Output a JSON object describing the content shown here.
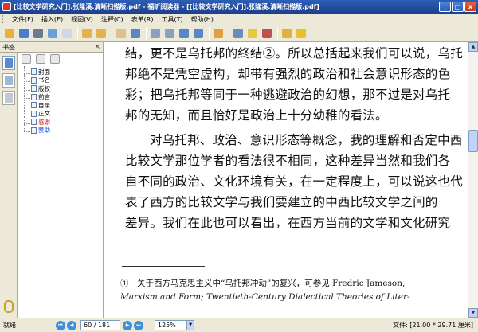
{
  "window": {
    "title": "[比较文学研究入门].张隆溪.清晰扫描版.pdf - 福昕阅读器 - [[比较文学研究入门].张隆溪.清晰扫描版.pdf]",
    "min": "_",
    "max": "□",
    "close": "x"
  },
  "menu": [
    "文件(F)",
    "插入(E)",
    "视图(V)",
    "注释(C)",
    "表单(R)",
    "工具(T)",
    "帮助(H)"
  ],
  "toolbar_icons": [
    {
      "name": "open-icon",
      "color": "#e8b23a"
    },
    {
      "name": "save-icon",
      "color": "#4a7fd0"
    },
    {
      "name": "print-icon",
      "color": "#6e7b8c"
    },
    {
      "name": "email-icon",
      "color": "#6aa0d8"
    },
    {
      "name": "thumbnail-icon",
      "color": "#d0d8e8"
    },
    {
      "name": "back-icon",
      "color": "#e2b44a"
    },
    {
      "name": "forward-icon",
      "color": "#e2b44a"
    },
    {
      "name": "hand-tool-icon",
      "color": "#e0c08a"
    },
    {
      "name": "zoom-in-icon",
      "color": "#5a86c8"
    },
    {
      "name": "fit-page-icon",
      "color": "#8aa0c0"
    },
    {
      "name": "fit-width-icon",
      "color": "#8aa0c0"
    },
    {
      "name": "zoom-out-icon",
      "color": "#5a86c8"
    },
    {
      "name": "zoom-plus-icon",
      "color": "#5a86c8"
    },
    {
      "name": "select-text-icon",
      "color": "#e0a040"
    },
    {
      "name": "snapshot-icon",
      "color": "#6a8ac0"
    },
    {
      "name": "note-icon",
      "color": "#e8c840"
    },
    {
      "name": "typewriter-icon",
      "color": "#c05050"
    },
    {
      "name": "highlight-icon",
      "color": "#e0b040"
    },
    {
      "name": "comment-icon",
      "color": "#e8c030"
    }
  ],
  "sidepanel": {
    "title": "书签",
    "close": "×",
    "bookmarks": [
      {
        "label": "封面",
        "color": "#000000"
      },
      {
        "label": "书名",
        "color": "#000000"
      },
      {
        "label": "版权",
        "color": "#000000"
      },
      {
        "label": "前言",
        "color": "#000000"
      },
      {
        "label": "目录",
        "color": "#000000"
      },
      {
        "label": "正文",
        "color": "#000000"
      },
      {
        "label": "感谢",
        "color": "#d02020"
      },
      {
        "label": "赞助",
        "color": "#2050d0"
      }
    ]
  },
  "document": {
    "lines": [
      "结，更不是乌托邦的终结②。所以总括起来我们可以说，乌托",
      "邦绝不是凭空虚构，却带有强烈的政治和社会意识形态的色",
      "彩；把乌托邦等同于一种逃避政治的幻想，那不过是对乌托",
      "邦的无知，而且恰好是政治上十分幼稚的看法。",
      "对乌托邦、政治、意识形态等概念，我的理解和否定中西",
      "比较文学那位学者的看法很不相同，这种差异当然和我们各",
      "自不同的政治、文化环境有关，在一定程度上，可以说这也代",
      "表了西方的比较文学与我们要建立的中西比较文学之间的",
      "差异。我们在此也可以看出，在西方当前的文学和文化研究"
    ],
    "footnote_1": "①　关于西方马克思主义中“乌托邦冲动”的复兴，可参见 Fredric Jameson,",
    "footnote_2": "Marxism and Form; Twentieth-Century Dialectical Theories of Liter-"
  },
  "status": {
    "ready": "就绪",
    "page": "60 / 181",
    "zoom": "125%",
    "file_size": "文件: [21.00 * 29.71 厘米]"
  }
}
